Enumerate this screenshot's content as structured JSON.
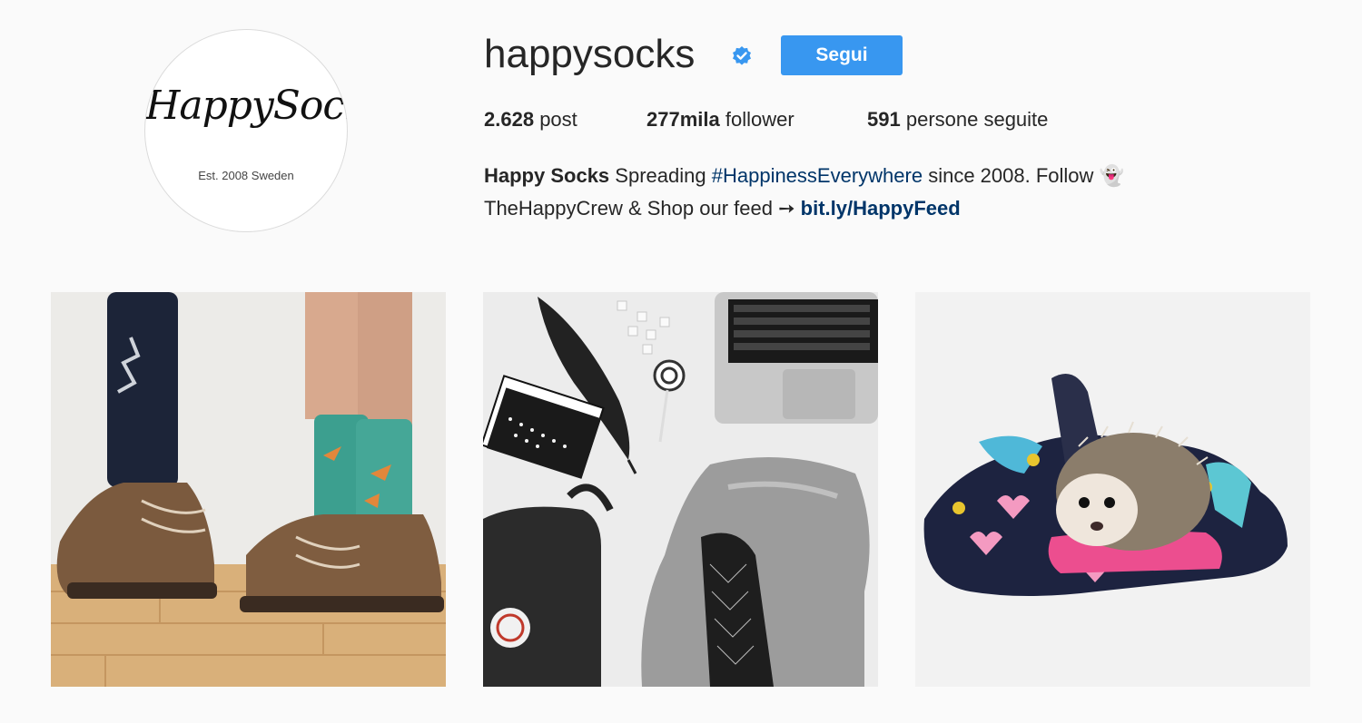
{
  "profile": {
    "avatar_logo": "HappySocks",
    "avatar_tagline": "Est. 2008 Sweden",
    "username": "happysocks",
    "verified_icon": "verified-badge-icon",
    "follow_label": "Segui",
    "accent_color": "#3897f0"
  },
  "stats": {
    "posts_count": "2.628",
    "posts_label": "post",
    "followers_count": "277mila",
    "followers_label": "follower",
    "following_count": "591",
    "following_label": "persone seguite"
  },
  "bio": {
    "name": "Happy Socks",
    "text1": "Spreading",
    "hashtag": "#HappinessEverywhere",
    "text2": "since 2008. Follow",
    "emoji": "👻",
    "text3": "TheHappyCrew & Shop our feed ➙",
    "link": "bit.ly/HappyFeed"
  },
  "posts": [
    {
      "subject": "boots-and-socks-photo"
    },
    {
      "subject": "flatlay-laptop-backpack-photo"
    },
    {
      "subject": "hedgehog-in-socks-photo"
    }
  ]
}
